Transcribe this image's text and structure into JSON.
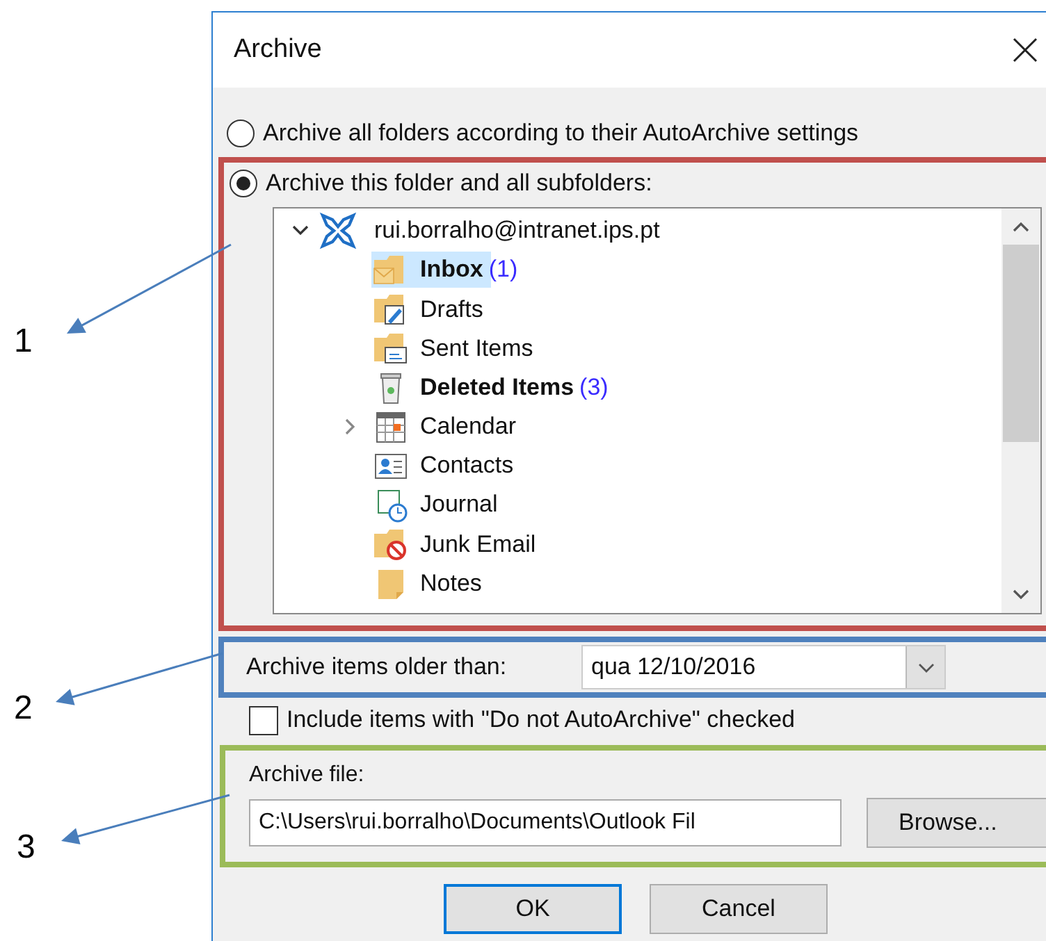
{
  "dialog": {
    "title": "Archive"
  },
  "options": [
    {
      "label": "Archive all folders according to their AutoArchive settings",
      "selected": false
    },
    {
      "label": "Archive this folder and all subfolders:",
      "selected": true
    }
  ],
  "folder_tree": {
    "label": "rui.borralho@intranet.ips.pt",
    "expanded": true,
    "children": [
      {
        "label": "Inbox",
        "count": "(1)",
        "bold": true,
        "selected": true
      },
      {
        "label": "Drafts",
        "bold": false,
        "selected": false
      },
      {
        "label": "Sent Items",
        "bold": false,
        "selected": false
      },
      {
        "label": "Deleted Items",
        "count": "(3)",
        "bold": true,
        "selected": false
      },
      {
        "label": "Calendar",
        "bold": false,
        "selected": false,
        "expanded": false
      },
      {
        "label": "Contacts",
        "bold": false,
        "selected": false
      },
      {
        "label": "Journal",
        "bold": false,
        "selected": false
      },
      {
        "label": "Junk Email",
        "bold": false,
        "selected": false
      },
      {
        "label": "Notes",
        "bold": false,
        "selected": false
      }
    ]
  },
  "older_than": {
    "label": "Archive items older than:",
    "value": "qua 12/10/2016"
  },
  "include_checkbox": {
    "label": "Include items with \"Do not AutoArchive\" checked",
    "checked": false
  },
  "archive_file": {
    "label": "Archive file:",
    "value": "C:\\Users\\rui.borralho\\Documents\\Outlook Fil",
    "browse": "Browse..."
  },
  "buttons": [
    {
      "label": "OK",
      "default": true
    },
    {
      "label": "Cancel",
      "default": false
    }
  ],
  "annotations": [
    {
      "label": "1"
    },
    {
      "label": "2"
    },
    {
      "label": "3"
    }
  ]
}
